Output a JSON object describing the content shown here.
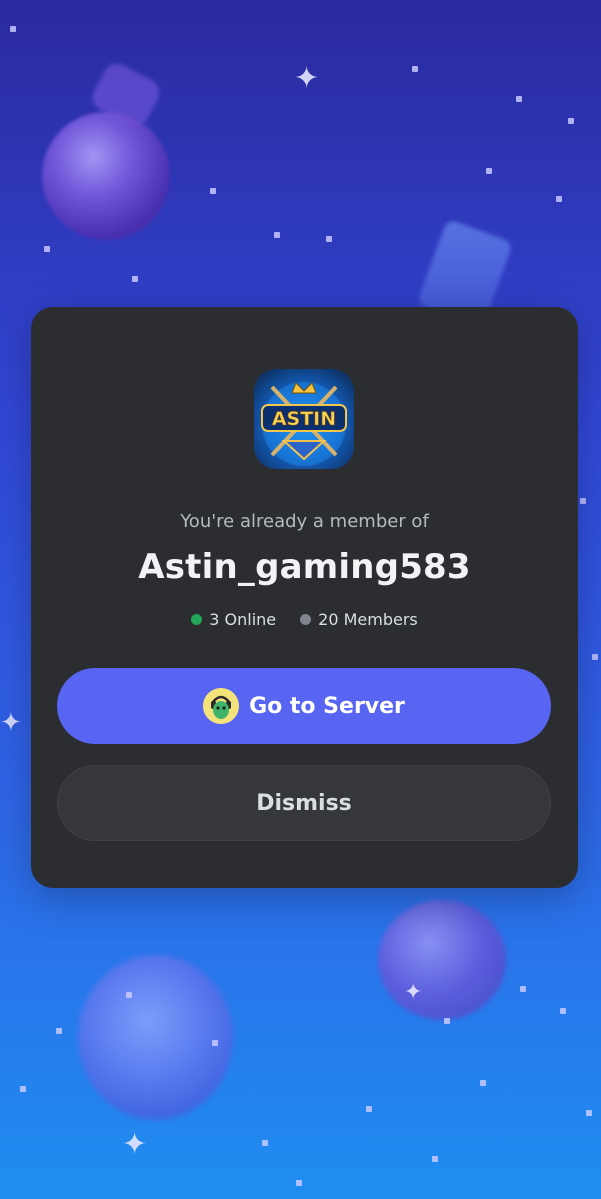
{
  "colors": {
    "card_bg": "#2b2d31",
    "primary": "#5865f2",
    "secondary_bg": "#35373c",
    "online": "#23a55a",
    "members": "#80848e"
  },
  "server": {
    "icon_text": "ASTIN",
    "intro_text": "You're already a member of",
    "name": "Astin_gaming583",
    "online_label": "3 Online",
    "members_label": "20 Members"
  },
  "actions": {
    "go_to_server_label": "Go to Server",
    "dismiss_label": "Dismiss"
  },
  "icons": {
    "server": "server-logo-icon",
    "online": "online-dot-icon",
    "members": "members-dot-icon",
    "avatar": "user-avatar-icon"
  }
}
